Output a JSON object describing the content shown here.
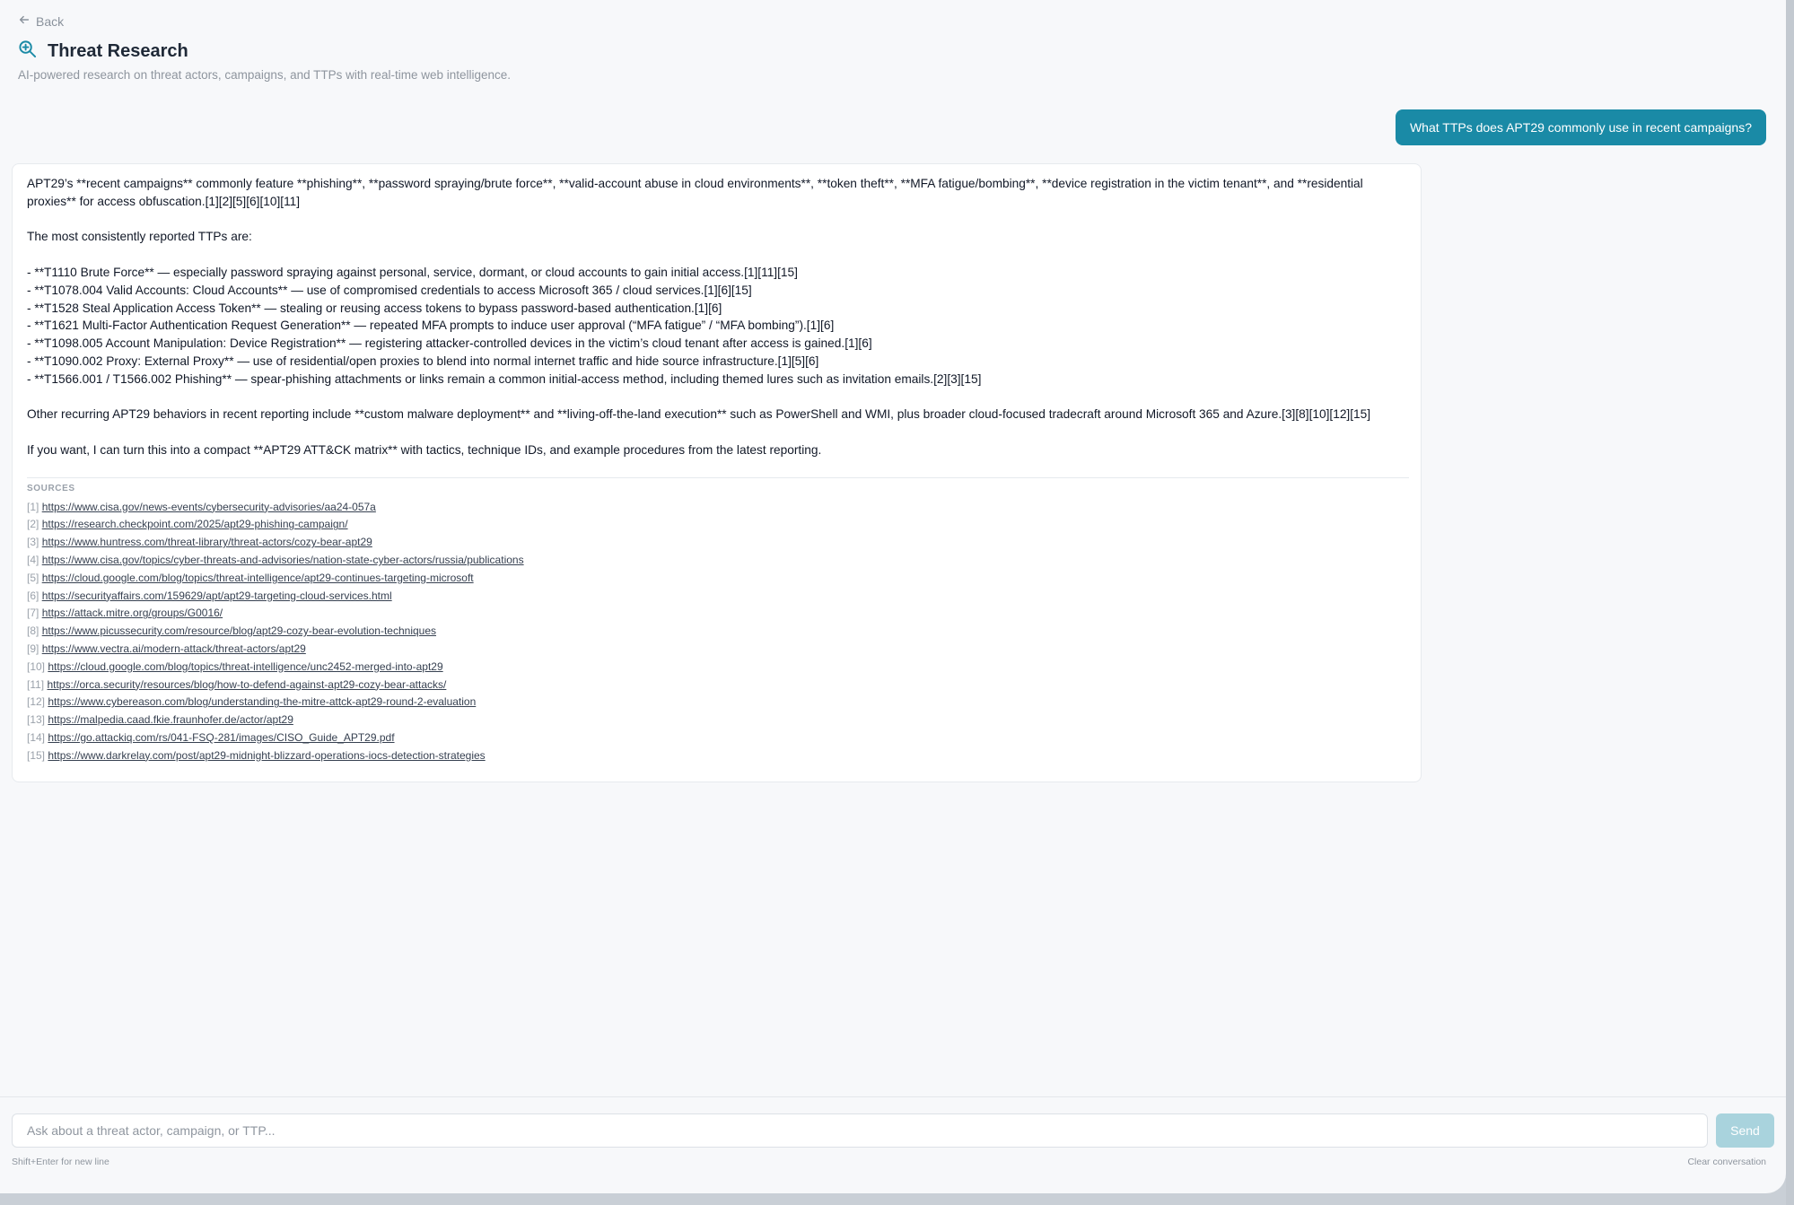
{
  "header": {
    "back_label": "Back",
    "title": "Threat Research",
    "subtitle": "AI-powered research on threat actors, campaigns, and TTPs with real-time web intelligence.",
    "icons": {
      "back": "arrow-left-icon",
      "title": "search-zoom-icon"
    }
  },
  "conversation": {
    "user_message": "What TTPs does APT29 commonly use in recent campaigns?",
    "answer": {
      "intro": "APT29’s **recent campaigns** commonly feature **phishing**, **password spraying/brute force**, **valid-account abuse in cloud environments**, **token theft**, **MFA fatigue/bombing**, **device registration in the victim tenant**, and **residential proxies** for access obfuscation.[1][2][5][6][10][11]",
      "lead": "The most consistently reported TTPs are:",
      "ttps": [
        "- **T1110 Brute Force** — especially password spraying against personal, service, dormant, or cloud accounts to gain initial access.[1][11][15]",
        "- **T1078.004 Valid Accounts: Cloud Accounts** — use of compromised credentials to access Microsoft 365 / cloud services.[1][6][15]",
        "- **T1528 Steal Application Access Token** — stealing or reusing access tokens to bypass password-based authentication.[1][6]",
        "- **T1621 Multi-Factor Authentication Request Generation** — repeated MFA prompts to induce user approval (“MFA fatigue” / “MFA bombing”).[1][6]",
        "- **T1098.005 Account Manipulation: Device Registration** — registering attacker-controlled devices in the victim’s cloud tenant after access is gained.[1][6]",
        "- **T1090.002 Proxy: External Proxy** — use of residential/open proxies to blend into normal internet traffic and hide source infrastructure.[1][5][6]",
        "- **T1566.001 / T1566.002 Phishing** — spear-phishing attachments or links remain a common initial-access method, including themed lures such as invitation emails.[2][3][15]"
      ],
      "other": "Other recurring APT29 behaviors in recent reporting include **custom malware deployment** and **living-off-the-land execution** such as PowerShell and WMI, plus broader cloud-focused tradecraft around Microsoft 365 and Azure.[3][8][10][12][15]",
      "offer": "If you want, I can turn this into a compact **APT29 ATT&CK matrix** with tactics, technique IDs, and example procedures from the latest reporting."
    },
    "sources_label": "SOURCES",
    "sources": [
      {
        "num": "[1]",
        "url": "https://www.cisa.gov/news-events/cybersecurity-advisories/aa24-057a"
      },
      {
        "num": "[2]",
        "url": "https://research.checkpoint.com/2025/apt29-phishing-campaign/"
      },
      {
        "num": "[3]",
        "url": "https://www.huntress.com/threat-library/threat-actors/cozy-bear-apt29"
      },
      {
        "num": "[4]",
        "url": "https://www.cisa.gov/topics/cyber-threats-and-advisories/nation-state-cyber-actors/russia/publications"
      },
      {
        "num": "[5]",
        "url": "https://cloud.google.com/blog/topics/threat-intelligence/apt29-continues-targeting-microsoft"
      },
      {
        "num": "[6]",
        "url": "https://securityaffairs.com/159629/apt/apt29-targeting-cloud-services.html"
      },
      {
        "num": "[7]",
        "url": "https://attack.mitre.org/groups/G0016/"
      },
      {
        "num": "[8]",
        "url": "https://www.picussecurity.com/resource/blog/apt29-cozy-bear-evolution-techniques"
      },
      {
        "num": "[9]",
        "url": "https://www.vectra.ai/modern-attack/threat-actors/apt29"
      },
      {
        "num": "[10]",
        "url": "https://cloud.google.com/blog/topics/threat-intelligence/unc2452-merged-into-apt29"
      },
      {
        "num": "[11]",
        "url": "https://orca.security/resources/blog/how-to-defend-against-apt29-cozy-bear-attacks/"
      },
      {
        "num": "[12]",
        "url": "https://www.cybereason.com/blog/understanding-the-mitre-attck-apt29-round-2-evaluation"
      },
      {
        "num": "[13]",
        "url": "https://malpedia.caad.fkie.fraunhofer.de/actor/apt29"
      },
      {
        "num": "[14]",
        "url": "https://go.attackiq.com/rs/041-FSQ-281/images/CISO_Guide_APT29.pdf"
      },
      {
        "num": "[15]",
        "url": "https://www.darkrelay.com/post/apt29-midnight-blizzard-operations-iocs-detection-strategies"
      }
    ]
  },
  "composer": {
    "placeholder": "Ask about a threat actor, campaign, or TTP...",
    "send_label": "Send",
    "hint": "Shift+Enter for new line",
    "clear_label": "Clear conversation"
  },
  "colors": {
    "accent": "#1a8aa6",
    "send_disabled": "#a9d3dd",
    "background": "#f7f8fa"
  }
}
